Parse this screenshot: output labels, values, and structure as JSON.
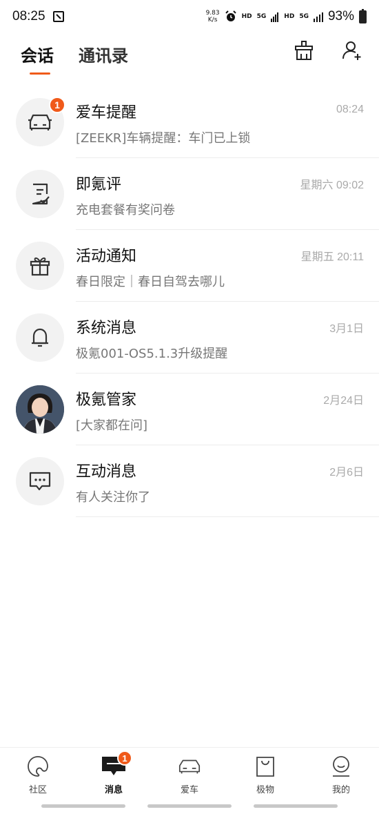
{
  "status_bar": {
    "time": "08:25",
    "net_speed_value": "9.83",
    "net_speed_unit": "K/s",
    "hd1": "HD",
    "sig1": "5G",
    "hd2": "HD",
    "sig2": "5G",
    "battery": "93%"
  },
  "header": {
    "tabs": [
      {
        "label": "会话",
        "active": true
      },
      {
        "label": "通讯录",
        "active": false
      }
    ],
    "actions": [
      "clean-icon",
      "add-contact-icon"
    ]
  },
  "conversations": [
    {
      "title": "爱车提醒",
      "subtitle": "[ZEEKR]车辆提醒：车门已上锁",
      "time": "08:24",
      "icon": "car-icon",
      "badge": "1"
    },
    {
      "title": "即氪评",
      "subtitle": "充电套餐有奖问卷",
      "time": "星期六 09:02",
      "icon": "survey-icon"
    },
    {
      "title": "活动通知",
      "subtitle": "春日限定｜春日自驾去哪儿",
      "time": "星期五 20:11",
      "icon": "gift-icon"
    },
    {
      "title": "系统消息",
      "subtitle": "极氪001-OS5.1.3升级提醒",
      "time": "3月1日",
      "icon": "bell-icon"
    },
    {
      "title": "极氪管家",
      "subtitle": "[大家都在问]",
      "time": "2月24日",
      "icon": "avatar-photo"
    },
    {
      "title": "互动消息",
      "subtitle": "有人关注你了",
      "time": "2月6日",
      "icon": "chat-icon"
    }
  ],
  "bottom_nav": [
    {
      "label": "社区",
      "icon": "community-icon"
    },
    {
      "label": "消息",
      "icon": "message-icon",
      "active": true,
      "badge": "1"
    },
    {
      "label": "爱车",
      "icon": "car-icon"
    },
    {
      "label": "极物",
      "icon": "shopping-bag-icon"
    },
    {
      "label": "我的",
      "icon": "profile-icon"
    }
  ],
  "colors": {
    "accent": "#f05a1a",
    "divider": "#ececec"
  }
}
